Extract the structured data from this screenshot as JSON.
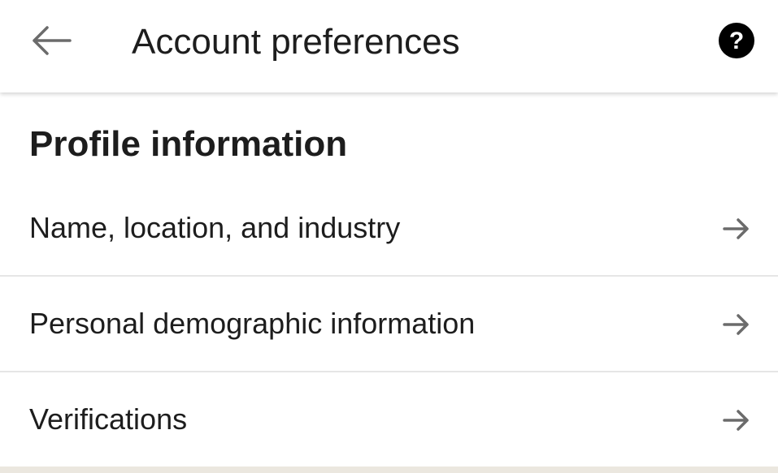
{
  "app_bar": {
    "title": "Account preferences",
    "back_icon": "arrow-left-icon",
    "help_icon": "help-circle-icon"
  },
  "section": {
    "title": "Profile information"
  },
  "items": [
    {
      "label": "Name, location, and industry",
      "icon": "arrow-right-icon"
    },
    {
      "label": "Personal demographic information",
      "icon": "arrow-right-icon"
    },
    {
      "label": "Verifications",
      "icon": "arrow-right-icon"
    }
  ],
  "colors": {
    "text": "#1d1d1d",
    "icon_gray": "#6b6b6b",
    "divider": "#e6e6e6",
    "background": "#ffffff",
    "strip": "#ebe7df"
  }
}
